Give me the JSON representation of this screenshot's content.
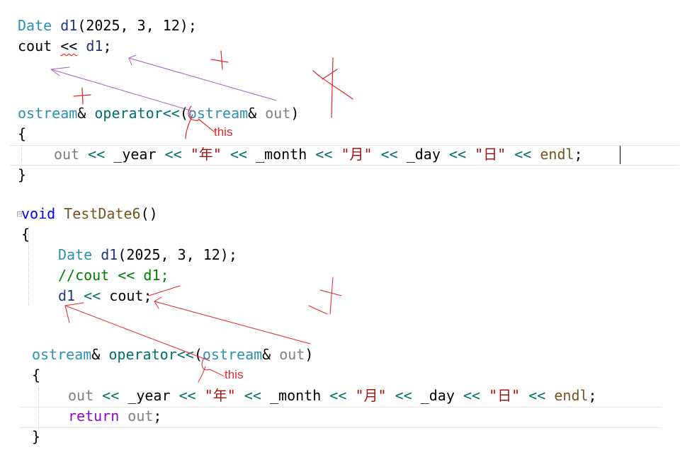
{
  "block1": {
    "line1": {
      "type": "Date",
      "var": "d1",
      "args": "(2025, 3, 12);"
    },
    "line2": {
      "cout": "cout",
      "op": "<<",
      "var": "d1",
      "semi": ";"
    }
  },
  "op_def1": {
    "sig": {
      "ret": "ostream",
      "amp": "&",
      "fn": "operator<<",
      "paren_open": "(",
      "ptype": "ostream",
      "pamp": "&",
      "pname": "out",
      "paren_close": ")"
    },
    "open_brace": "{",
    "body": {
      "out": "out",
      "op": "<<",
      "year": "_year",
      "s_year": "\"年\"",
      "month": "_month",
      "s_month": "\"月\"",
      "day": "_day",
      "s_day": "\"日\"",
      "endl": "endl",
      "semi": ";"
    },
    "close_brace": "}",
    "annotation": "this"
  },
  "test_fn": {
    "sig": {
      "kw": "void",
      "name": "TestDate6",
      "parens": "()"
    },
    "open_brace": "{",
    "line1": {
      "type": "Date",
      "var": "d1",
      "args": "(2025, 3, 12);"
    },
    "comment": "//cout << d1;",
    "line3": {
      "var": "d1",
      "op": "<<",
      "cout": "cout",
      "semi": ";"
    }
  },
  "op_def2": {
    "sig": {
      "ret": "ostream",
      "amp": "&",
      "fn": "operator<<",
      "paren_open": "(",
      "ptype": "ostream",
      "pamp": "&",
      "pname": "out",
      "paren_close": ")"
    },
    "open_brace": "{",
    "body": {
      "out": "out",
      "op": "<<",
      "year": "_year",
      "s_year": "\"年\"",
      "month": "_month",
      "s_month": "\"月\"",
      "day": "_day",
      "s_day": "\"日\"",
      "endl": "endl",
      "semi": ";"
    },
    "ret_kw": "return",
    "ret_val": "out",
    "ret_semi": ";",
    "close_brace": "}",
    "annotation": "this"
  },
  "colors": {
    "type": "#2b91af",
    "function": "#00706b",
    "variable": "#1f377f",
    "parameter": "#808080",
    "string": "#a31515",
    "keyword": "#8f08c4",
    "void": "#0000ff",
    "comment": "#008000",
    "annotation_red": "#e0262b",
    "annotation_purple": "#a65cc7"
  }
}
